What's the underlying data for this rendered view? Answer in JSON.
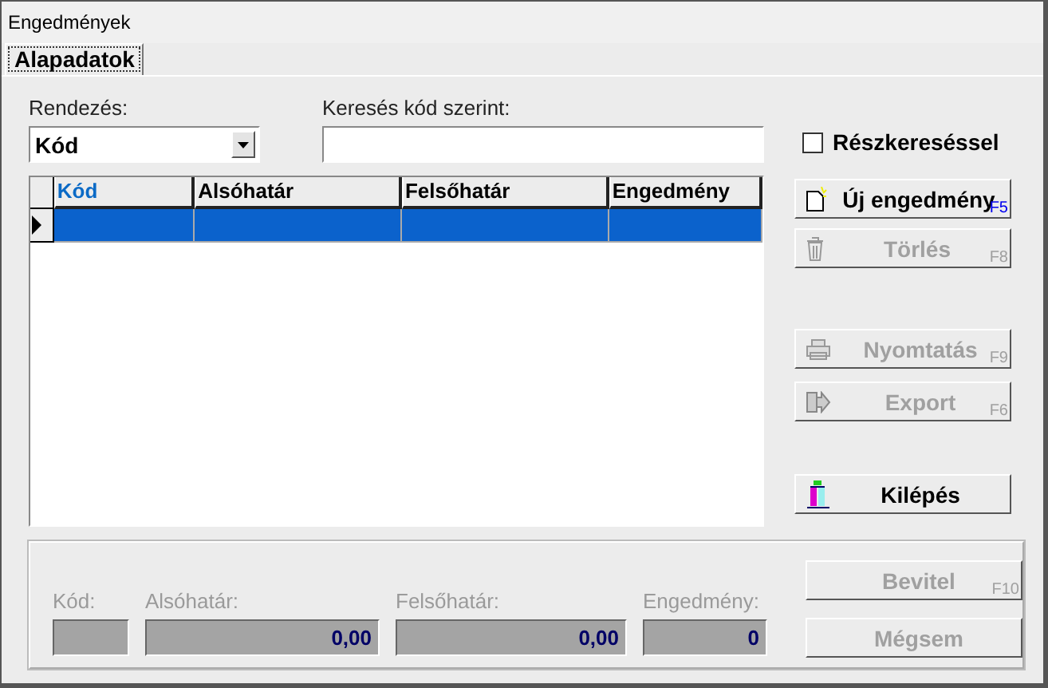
{
  "window": {
    "title": "Engedmények"
  },
  "tabs": [
    {
      "label": "Alapadatok",
      "selected": true
    }
  ],
  "sort": {
    "label": "Rendezés:",
    "value": "Kód"
  },
  "search": {
    "label": "Keresés kód szerint:"
  },
  "partial_search": {
    "label": "Részkereséssel",
    "checked": false
  },
  "table": {
    "columns": [
      {
        "label": "Kód",
        "sorted": true
      },
      {
        "label": "Alsóhatár",
        "sorted": false
      },
      {
        "label": "Felsőhatár",
        "sorted": false
      },
      {
        "label": "Engedmény",
        "sorted": false
      }
    ],
    "rows": [
      {
        "selected": true
      }
    ]
  },
  "side_buttons": [
    {
      "label": "Új engedmény",
      "shortcut": "F5",
      "kind": "new",
      "disabled": false
    },
    {
      "label": "Törlés",
      "shortcut": "F8",
      "kind": "trash",
      "disabled": true
    },
    {
      "label": "Nyomtatás",
      "shortcut": "F9",
      "kind": "print",
      "disabled": true
    },
    {
      "label": "Export",
      "shortcut": "F6",
      "kind": "export",
      "disabled": true
    },
    {
      "label": "Kilépés",
      "kind": "exit",
      "disabled": false
    }
  ],
  "edit_form": {
    "disabled": true,
    "fields": [
      {
        "label": "Kód:"
      },
      {
        "label": "Alsóhatár:",
        "value": "0,00"
      },
      {
        "label": "Felsőhatár:",
        "value": "0,00"
      },
      {
        "label": "Engedmény:",
        "value": "0"
      }
    ],
    "buttons": [
      {
        "label": "Bevitel",
        "shortcut": "F10",
        "disabled": true
      },
      {
        "label": "Mégsem",
        "disabled": true
      }
    ]
  }
}
